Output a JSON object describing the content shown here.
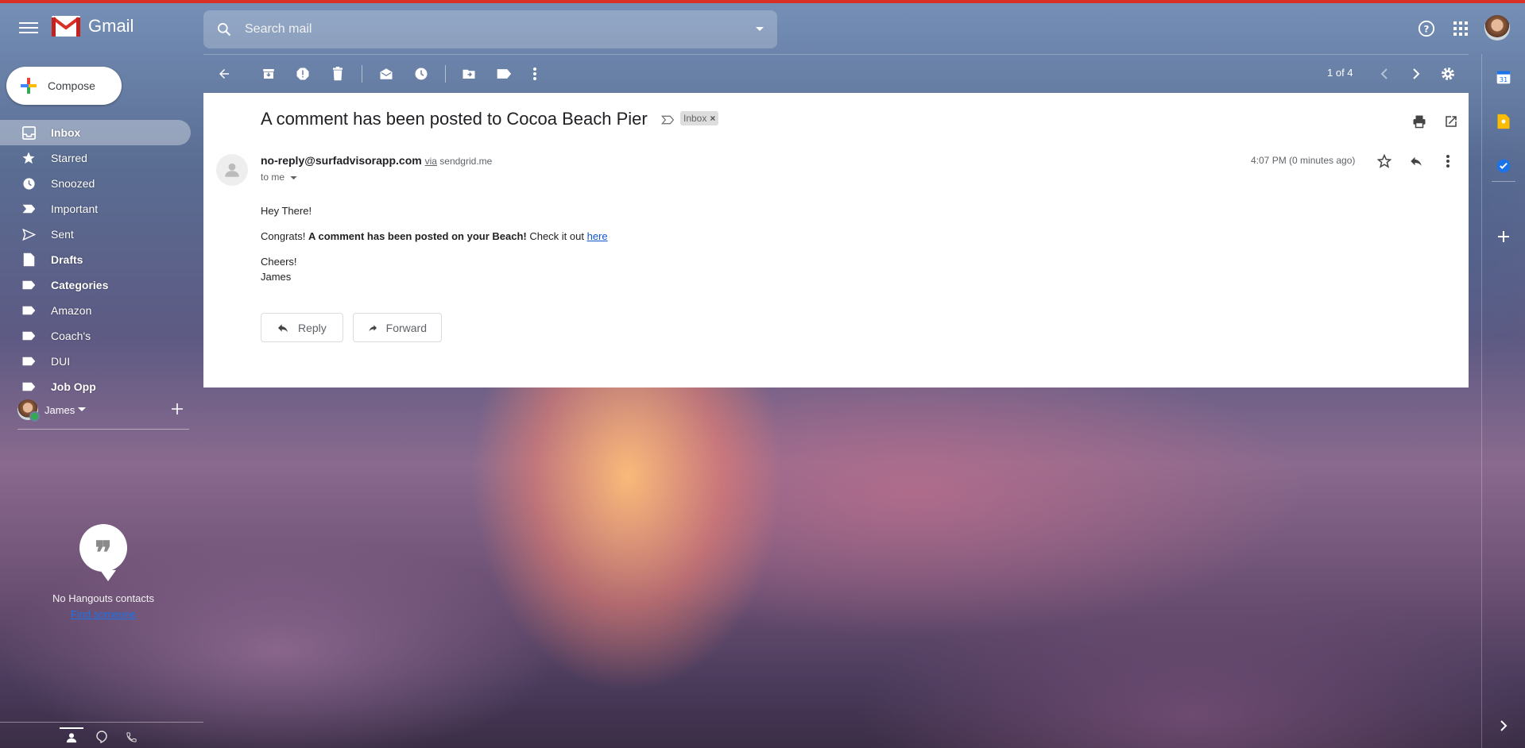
{
  "app": {
    "name": "Gmail"
  },
  "search": {
    "placeholder": "Search mail"
  },
  "pager": {
    "text": "1 of 4"
  },
  "compose": {
    "label": "Compose"
  },
  "nav": [
    {
      "label": "Inbox",
      "icon": "inbox-icon",
      "active": true
    },
    {
      "label": "Starred",
      "icon": "star-icon"
    },
    {
      "label": "Snoozed",
      "icon": "clock-icon"
    },
    {
      "label": "Important",
      "icon": "important-icon"
    },
    {
      "label": "Sent",
      "icon": "send-icon"
    },
    {
      "label": "Drafts",
      "icon": "draft-icon"
    },
    {
      "label": "Categories",
      "icon": "label-icon"
    },
    {
      "label": "Amazon",
      "icon": "label-icon"
    },
    {
      "label": "Coach's",
      "icon": "label-icon"
    },
    {
      "label": "DUI",
      "icon": "label-icon"
    },
    {
      "label": "Job Opp",
      "icon": "label-icon"
    }
  ],
  "user": {
    "name": "James"
  },
  "hangouts": {
    "empty_text": "No Hangouts contacts",
    "find_link": "Find someone"
  },
  "email": {
    "subject": "A comment has been posted to Cocoa Beach Pier",
    "label_chip": "Inbox",
    "sender": "no-reply@surfadvisorapp.com",
    "via_word": "via",
    "via_domain": "sendgrid.me",
    "to": "to me",
    "time": "4:07 PM (0 minutes ago)",
    "greeting": "Hey There!",
    "line_prefix": "Congrats! ",
    "line_bold": "A comment has been posted on your Beach!",
    "line_suffix": " Check it out ",
    "link_text": "here",
    "signoff": "Cheers!",
    "signature": "James"
  },
  "actions": {
    "reply": "Reply",
    "forward": "Forward"
  },
  "colors": {
    "accent_red": "#d93025",
    "link": "#1155cc"
  }
}
